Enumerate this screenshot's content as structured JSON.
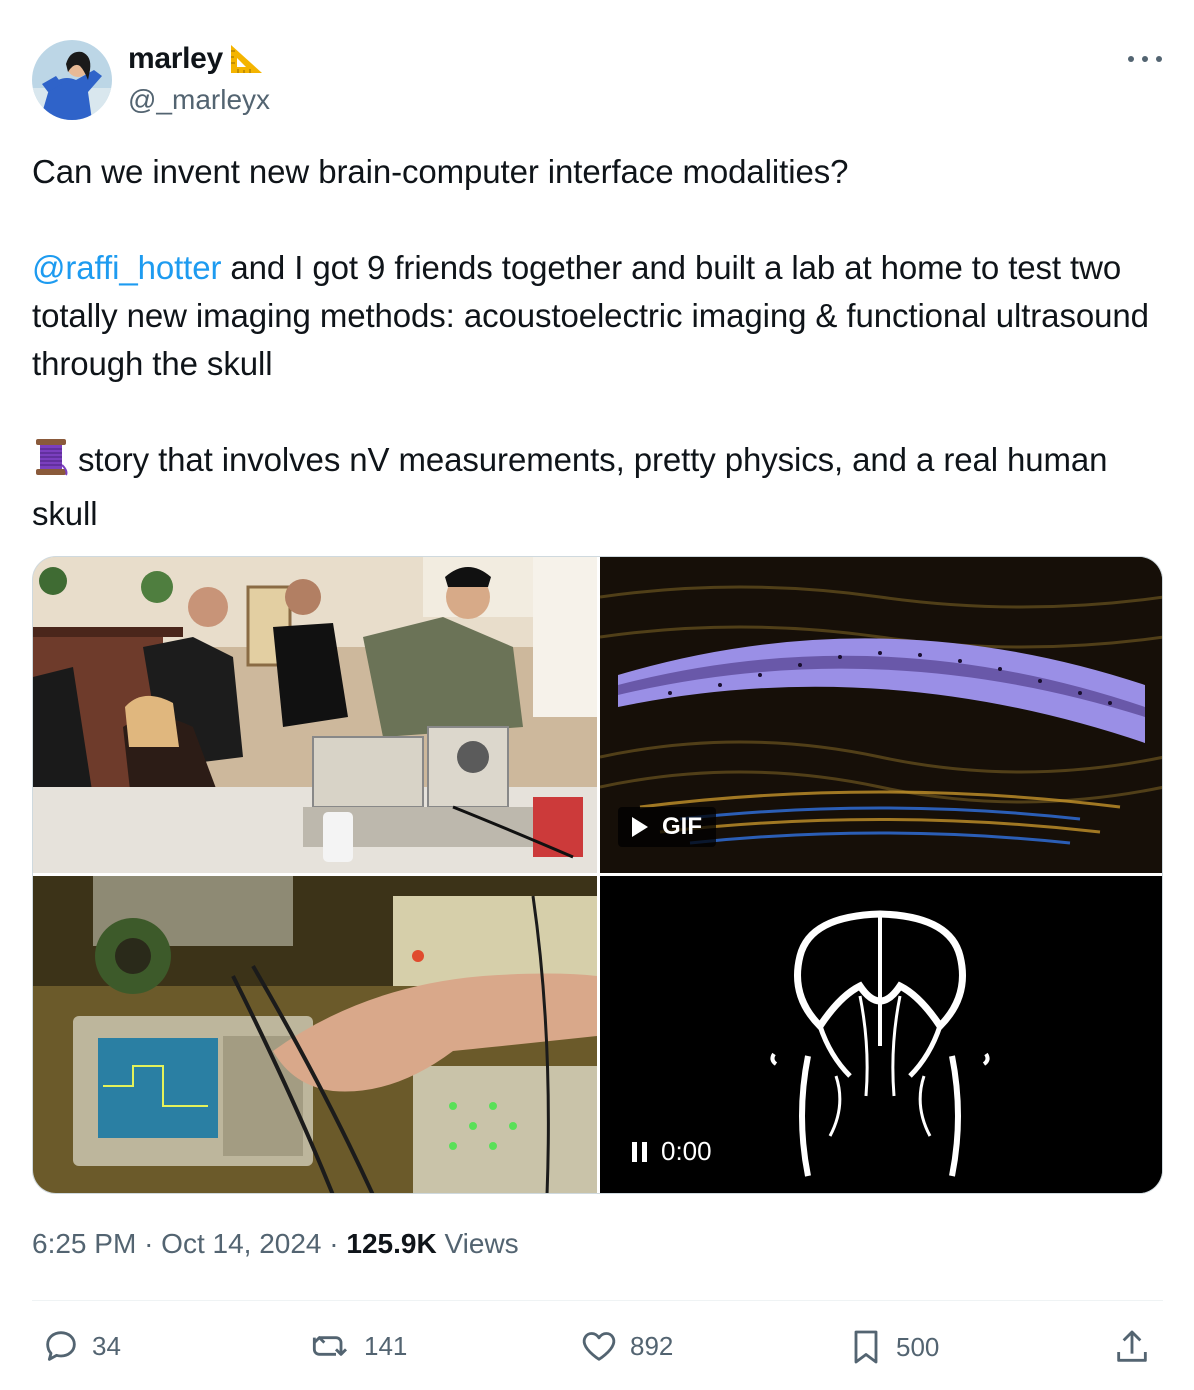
{
  "author": {
    "display_name": "marley",
    "badge_emoji": "triangular-ruler",
    "handle": "@_marleyx"
  },
  "tweet": {
    "line1": "Can we invent new brain-computer interface modalities?",
    "mention": "@raffi_hotter",
    "paragraph2": " and I got 9 friends together and built a lab at home to test two totally new imaging methods: acoustoelectric imaging & functional ultrasound through the skull",
    "thread_emoji": "spool-of-thread",
    "paragraph3": "story that involves nV measurements, pretty physics, and a real human skull"
  },
  "media": {
    "gif_label": "GIF",
    "video_time": "0:00"
  },
  "meta": {
    "time": "6:25 PM",
    "separator": "·",
    "date": "Oct 14, 2024",
    "views_count": "125.9K",
    "views_label": "Views"
  },
  "actions": {
    "replies": "34",
    "reposts": "141",
    "likes": "892",
    "bookmarks": "500"
  },
  "colors": {
    "text": "#0f1419",
    "secondary": "#536471",
    "link": "#1d9bf0",
    "border": "#cfd9de"
  }
}
